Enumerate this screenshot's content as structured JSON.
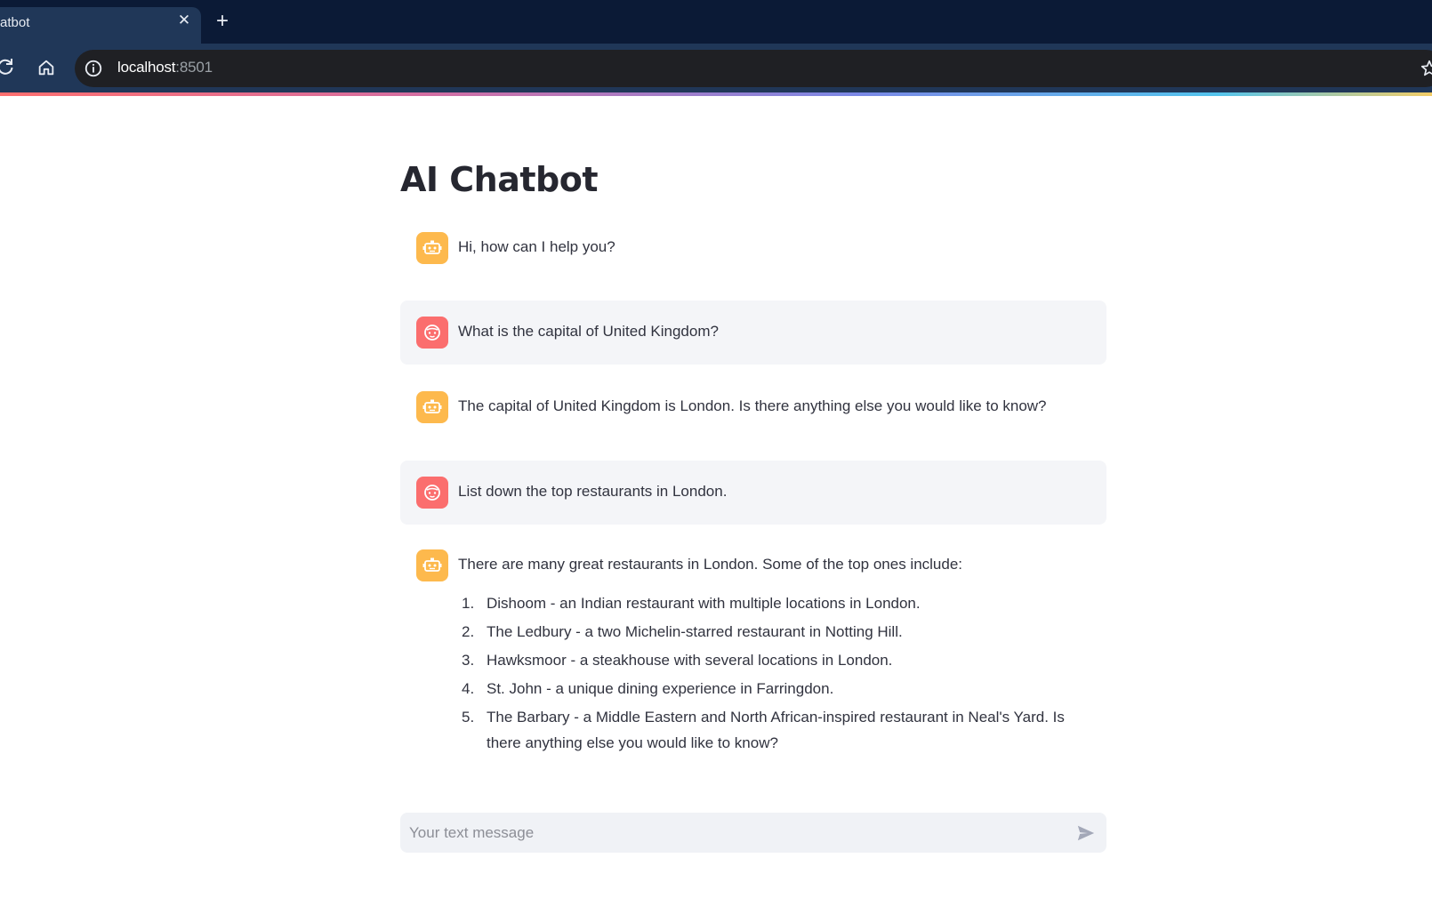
{
  "browser": {
    "tab_title": "atbot",
    "close_glyph": "✕",
    "newtab_glyph": "+",
    "url_host": "localhost",
    "url_port": ":8501"
  },
  "app": {
    "title": "AI Chatbot",
    "messages": [
      {
        "role": "assistant",
        "text": "Hi, how can I help you?"
      },
      {
        "role": "user",
        "text": "What is the capital of United Kingdom?"
      },
      {
        "role": "assistant",
        "text": "The capital of United Kingdom is London. Is there anything else you would like to know?"
      },
      {
        "role": "user",
        "text": "List down the top restaurants in London."
      },
      {
        "role": "assistant",
        "text": "There are many great restaurants in London. Some of the top ones include:",
        "list": [
          {
            "num": "1.",
            "text": "Dishoom - an Indian restaurant with multiple locations in London."
          },
          {
            "num": "2.",
            "text": "The Ledbury - a two Michelin-starred restaurant in Notting Hill."
          },
          {
            "num": "3.",
            "text": "Hawksmoor - a steakhouse with several locations in London."
          },
          {
            "num": "4.",
            "text": "St. John - a unique dining experience in Farringdon."
          },
          {
            "num": "5.",
            "text": "The Barbary - a Middle Eastern and North African-inspired restaurant in Neal's Yard. Is there anything else you would like to know?"
          }
        ]
      }
    ],
    "chat_input": {
      "placeholder": "Your text message",
      "value": ""
    }
  },
  "colors": {
    "assistant_avatar": "#fdb94d",
    "user_avatar": "#fb6e6e",
    "user_bubble": "#f4f5f8",
    "input_bg": "#f0f2f6"
  },
  "icons": [
    "reload-icon",
    "home-icon",
    "info-icon",
    "zoom-icon",
    "star-icon",
    "bot-icon",
    "user-face-icon",
    "send-icon"
  ]
}
